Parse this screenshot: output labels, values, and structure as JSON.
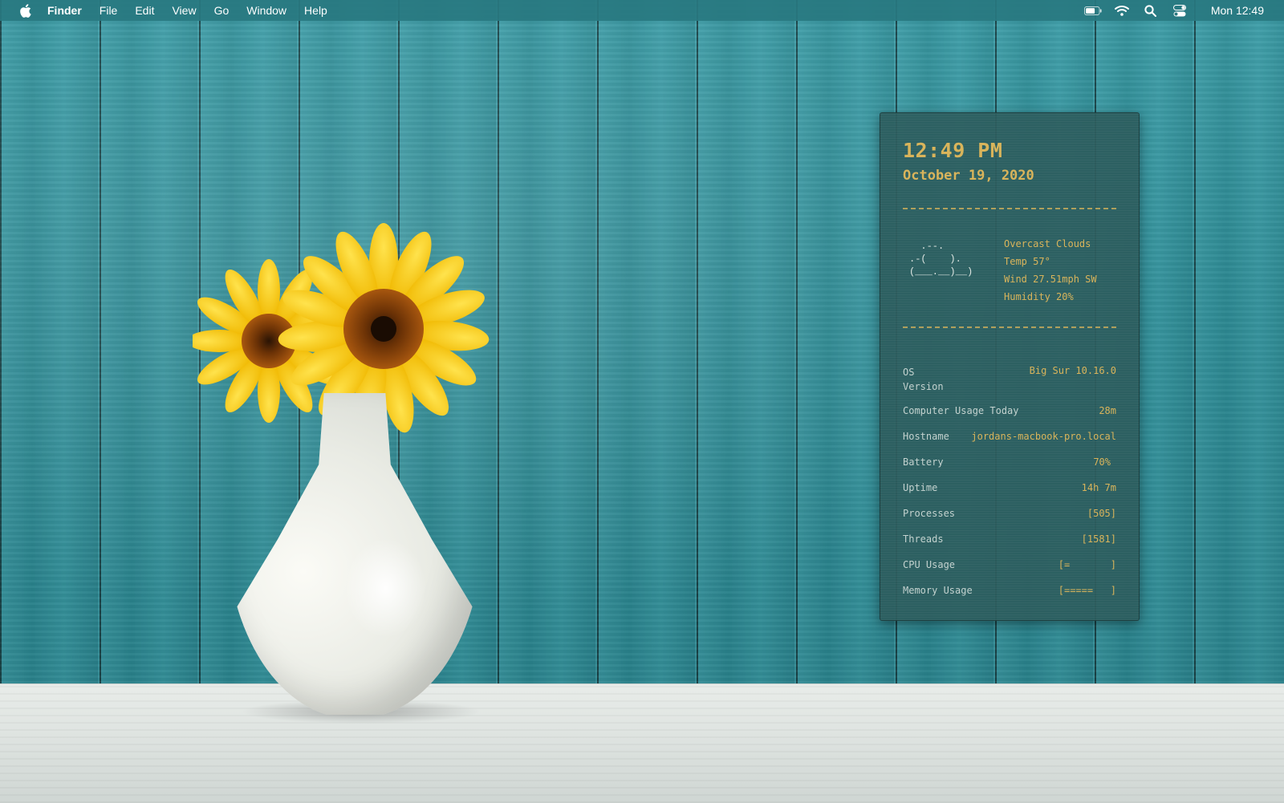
{
  "menubar": {
    "apple_icon": "apple-logo-icon",
    "app_name": "Finder",
    "items": [
      "File",
      "Edit",
      "View",
      "Go",
      "Window",
      "Help"
    ],
    "status_icons": [
      "battery-icon",
      "wifi-icon",
      "search-icon",
      "control-center-icon"
    ],
    "clock": "Mon 12:49"
  },
  "widget": {
    "time": "12:49 PM",
    "date": "October 19, 2020",
    "weather_art": "  .--.\n.-(    ).\n(___.__)__)",
    "weather": {
      "condition": "Overcast Clouds",
      "temp": "Temp 57°",
      "wind": "Wind 27.51mph SW",
      "humidity": "Humidity 20%"
    },
    "stats": [
      {
        "label": "OS\nVersion",
        "value": "Big Sur 10.16.0"
      },
      {
        "label": "Computer Usage Today",
        "value": "28m"
      },
      {
        "label": "Hostname",
        "value": "jordans-macbook-pro.local"
      },
      {
        "label": "Battery",
        "value": "70%"
      },
      {
        "label": "Uptime",
        "value": "14h 7m"
      },
      {
        "label": "Processes",
        "value": "[505]"
      },
      {
        "label": "Threads",
        "value": "[1581]"
      },
      {
        "label": "CPU Usage",
        "value": "[=       ]"
      },
      {
        "label": "Memory Usage",
        "value": "[=====   ]"
      }
    ]
  },
  "colors": {
    "menubar": "#28787f",
    "widget_bg": "#2c5c5e",
    "widget_text": "#d9b45b",
    "widget_label": "#c3d2cf",
    "wall": "#2f8f99"
  }
}
